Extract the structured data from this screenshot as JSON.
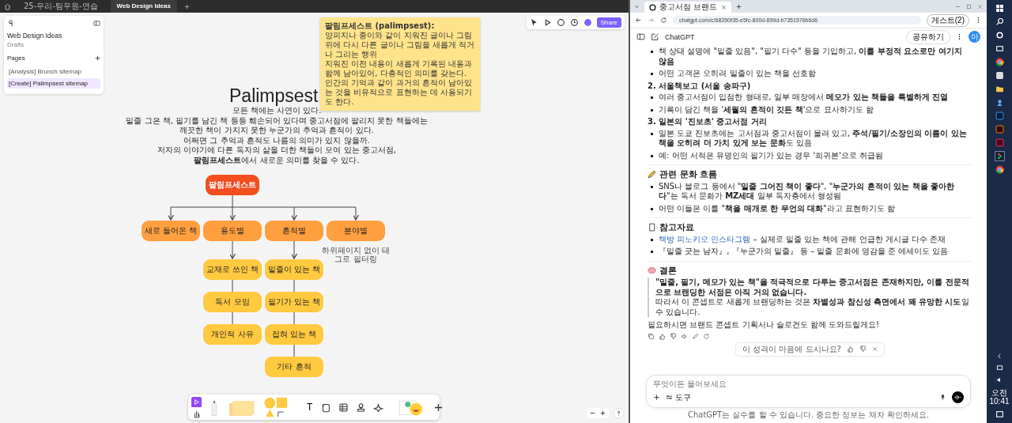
{
  "figjam": {
    "tabs": [
      {
        "label": "25-우리-팀우원-연습",
        "selected": false
      },
      {
        "label": "Web Design Ideas",
        "selected": true
      }
    ],
    "sidebar": {
      "file_name": "Web Design Ideas",
      "location": "Drafts",
      "pages_heading": "Pages",
      "pages": [
        {
          "label": "[Analysis] Brunch sitemap",
          "selected": false
        },
        {
          "label": "[Create] Palimpsest sitemap",
          "selected": true
        }
      ]
    },
    "share_button": "Share",
    "sticky_note": {
      "title": "팔림프세스트 (palimpsest):",
      "lines": [
        "양피지나 종이와 같이 지워진 글이나 그림 위에 다시 다른 글이나 그림을 새롭게 적거나 그리는 행위",
        "지워진 이전 내용이 새롭게 기록된 내용과 함께 남아있어, 다층적인 의미를 갖는다.",
        "인간의 기억과 같이 과거의 흔적이 남아있는 것을 비유적으로 표현하는 데 사용되기도 한다."
      ]
    },
    "title": "Palimpsest",
    "intro": [
      "모든 책에는 사연이 있다.",
      "밑줄 그은 책, 필기를 남긴 책 등등 훼손되어 있다며 중고서점에 팔리지 못한 책들에는",
      "깨끗한 책이 가지지 못한 누군가의 추억과 흔적이 있다.",
      "어쩌면 그 추억과 흔적도 나름의 의미가 있지 않을까.",
      "저자의 이야기에 다른 독자의 삶을 더한 책들이 모여 있는 중고서점,",
      "**팔림프세스트**에서 새로운 의미를 찾을 수 있다."
    ],
    "sitemap": {
      "root": "팔림프세스트",
      "branches": [
        {
          "label": "새로 들어온 책"
        },
        {
          "label": "용도별",
          "children": [
            "교재로 쓰인 책",
            "독서 모임",
            "개인적 사유"
          ]
        },
        {
          "label": "흔적별",
          "children": [
            "밑줄이 있는 책",
            "필기가 있는 책",
            "접혀 있는 책",
            "기타 흔적"
          ]
        },
        {
          "label": "분야별",
          "note": "하위페이지 없이 태그로 필터링"
        }
      ]
    },
    "toolbar": {
      "text_tool": "T"
    }
  },
  "browser": {
    "tab": "중고서점 브랜드",
    "url": "chatgpt.com/c/68350f35-e5fc-800d-899d-b7351576b6d6",
    "profile_button": "게스트(2)",
    "chat": {
      "model": "ChatGPT",
      "share_button": "공유하기",
      "avatar": "아",
      "blocks": [
        {
          "kind": "bullet",
          "text": "책 상태 설명에 \"밑줄 있음\", \"필기 다수\" 등을 기입하고, **이를 부정적 요소로만 여기지 않음**"
        },
        {
          "kind": "bullet",
          "text": "어떤 고객은 오히려 밑줄이 있는 책을 선호함"
        },
        {
          "kind": "heading",
          "text": "2. 서울책보고 (서울 송파구)"
        },
        {
          "kind": "bullet",
          "text": "여러 중고서점이 입점한 형태로, 일부 매장에서 **메모가 있는 책들을 특별하게 진열**"
        },
        {
          "kind": "bullet",
          "text": "기록이 담긴 책을 '**세월의 흔적이 깃든 책**'으로 묘사하기도 함"
        },
        {
          "kind": "heading",
          "text": "3. 일본의 '진보초' 중고서점 거리"
        },
        {
          "kind": "bullet",
          "text": "일본 도쿄 진보초에는 고서점과 중고서점이 몰려 있고, **주석/필기/소장인의 이름이 있는 책을 오히려 더 가치 있게 보는 문화**도 있음"
        },
        {
          "kind": "bullet",
          "text": "예: 어떤 서적은 유명인의 필기가 있는 경우 '희귀본'으로 취급됨"
        },
        {
          "kind": "divider"
        },
        {
          "kind": "section",
          "text": "관련 문화 흐름"
        },
        {
          "kind": "bullet",
          "text": "SNS나 블로그 등에서 \"**밑줄 그어진 책이 좋다**\", \"**누군가의 흔적이 있는 책을 좋아한다**\"는 독서 문화가 **MZ세대** 일부 독자층에서 형성됨"
        },
        {
          "kind": "bullet",
          "text": "어떤 이들은 이를 \"**책을 매개로 한 무언의 대화**\"라고 표현하기도 함"
        },
        {
          "kind": "divider"
        },
        {
          "kind": "section",
          "text": "참고자료"
        },
        {
          "kind": "link_bullet",
          "link": "책방 피노키오 인스타그램",
          "text": "– 실제로 밑줄 있는 책에 관해 언급한 게시글 다수 존재"
        },
        {
          "kind": "bullet",
          "text": "『밑줄 긋는 남자』, 『누군가의 밑줄』 등 – 밑줄 문화에 영감을 준 에세이도 있음"
        },
        {
          "kind": "divider"
        },
        {
          "kind": "section",
          "text": "결론"
        },
        {
          "kind": "quote",
          "lead": "\"밑줄, 필기, 메모가 있는 책\"을 적극적으로 다루는 중고서점은 존재하지만, 이를 전문적으로 브랜딩한 서점은 아직 거의 없습니다.",
          "text": "따라서 이 콘셉트로 새롭게 브랜딩하는 것은 **차별성과 참신성 측면에서 꽤 유망한 시도**일 수 있습니다."
        },
        {
          "kind": "paragraph",
          "text": "필요하시면 브랜드 콘셉트 기획서나 슬로건도 함께 도와드릴게요!"
        }
      ],
      "feedback": "이 성격이 마음에 드시나요?",
      "composer": {
        "placeholder": "무엇이든 물어보세요",
        "tools_button": "도구"
      },
      "disclaimer": "ChatGPT는 실수를 할 수 있습니다. 중요한 정보는 재차 확인하세요."
    }
  },
  "taskbar": {
    "time": "오전 10:41"
  }
}
